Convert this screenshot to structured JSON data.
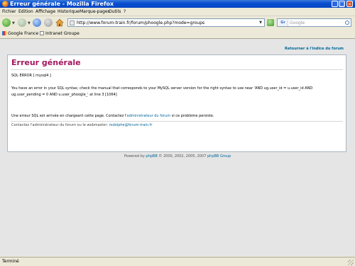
{
  "window": {
    "title": "Erreur générale - Mozilla Firefox"
  },
  "menu": [
    "Fichier",
    "Edition",
    "Affichage",
    "Historique",
    "Marque-pages",
    "Outils",
    "?"
  ],
  "nav": {
    "url": "http://www.forum-train.fr/forum/phoogle.php?mode=groups",
    "search_placeholder": "Google"
  },
  "bookmarks": [
    "Google France",
    "Intranet Groupe"
  ],
  "page": {
    "return_link": "Retourner à l'indice du forum",
    "title": "Erreur générale",
    "sql_error": "SQL ERROR [ mysql4 ]",
    "sql_message": "You have an error in your SQL syntax; check the manual that corresponds to your MySQL server version for the right syntax to use near 'AND ug.user_id = u.user_id AND ug.user_pending = 0 AND u.user_phoogle_' at line 3 [1064]",
    "generic_prefix": "Une erreur SQL est arrivée en chargeant cette page. Contactez l'",
    "generic_link": "administrateur du forum",
    "generic_suffix": " si ce problème persiste.",
    "contact_prefix": "Contactez l'administrateur du forum ou le webmaster: ",
    "contact_email": "rodolphe@forum-train.fr",
    "footer_prefix": "Powered by ",
    "footer_link1": "phpBB",
    "footer_middle": " © 2000, 2002, 2005, 2007 ",
    "footer_link2": "phpBB Group"
  },
  "status": {
    "text": "Terminé"
  }
}
